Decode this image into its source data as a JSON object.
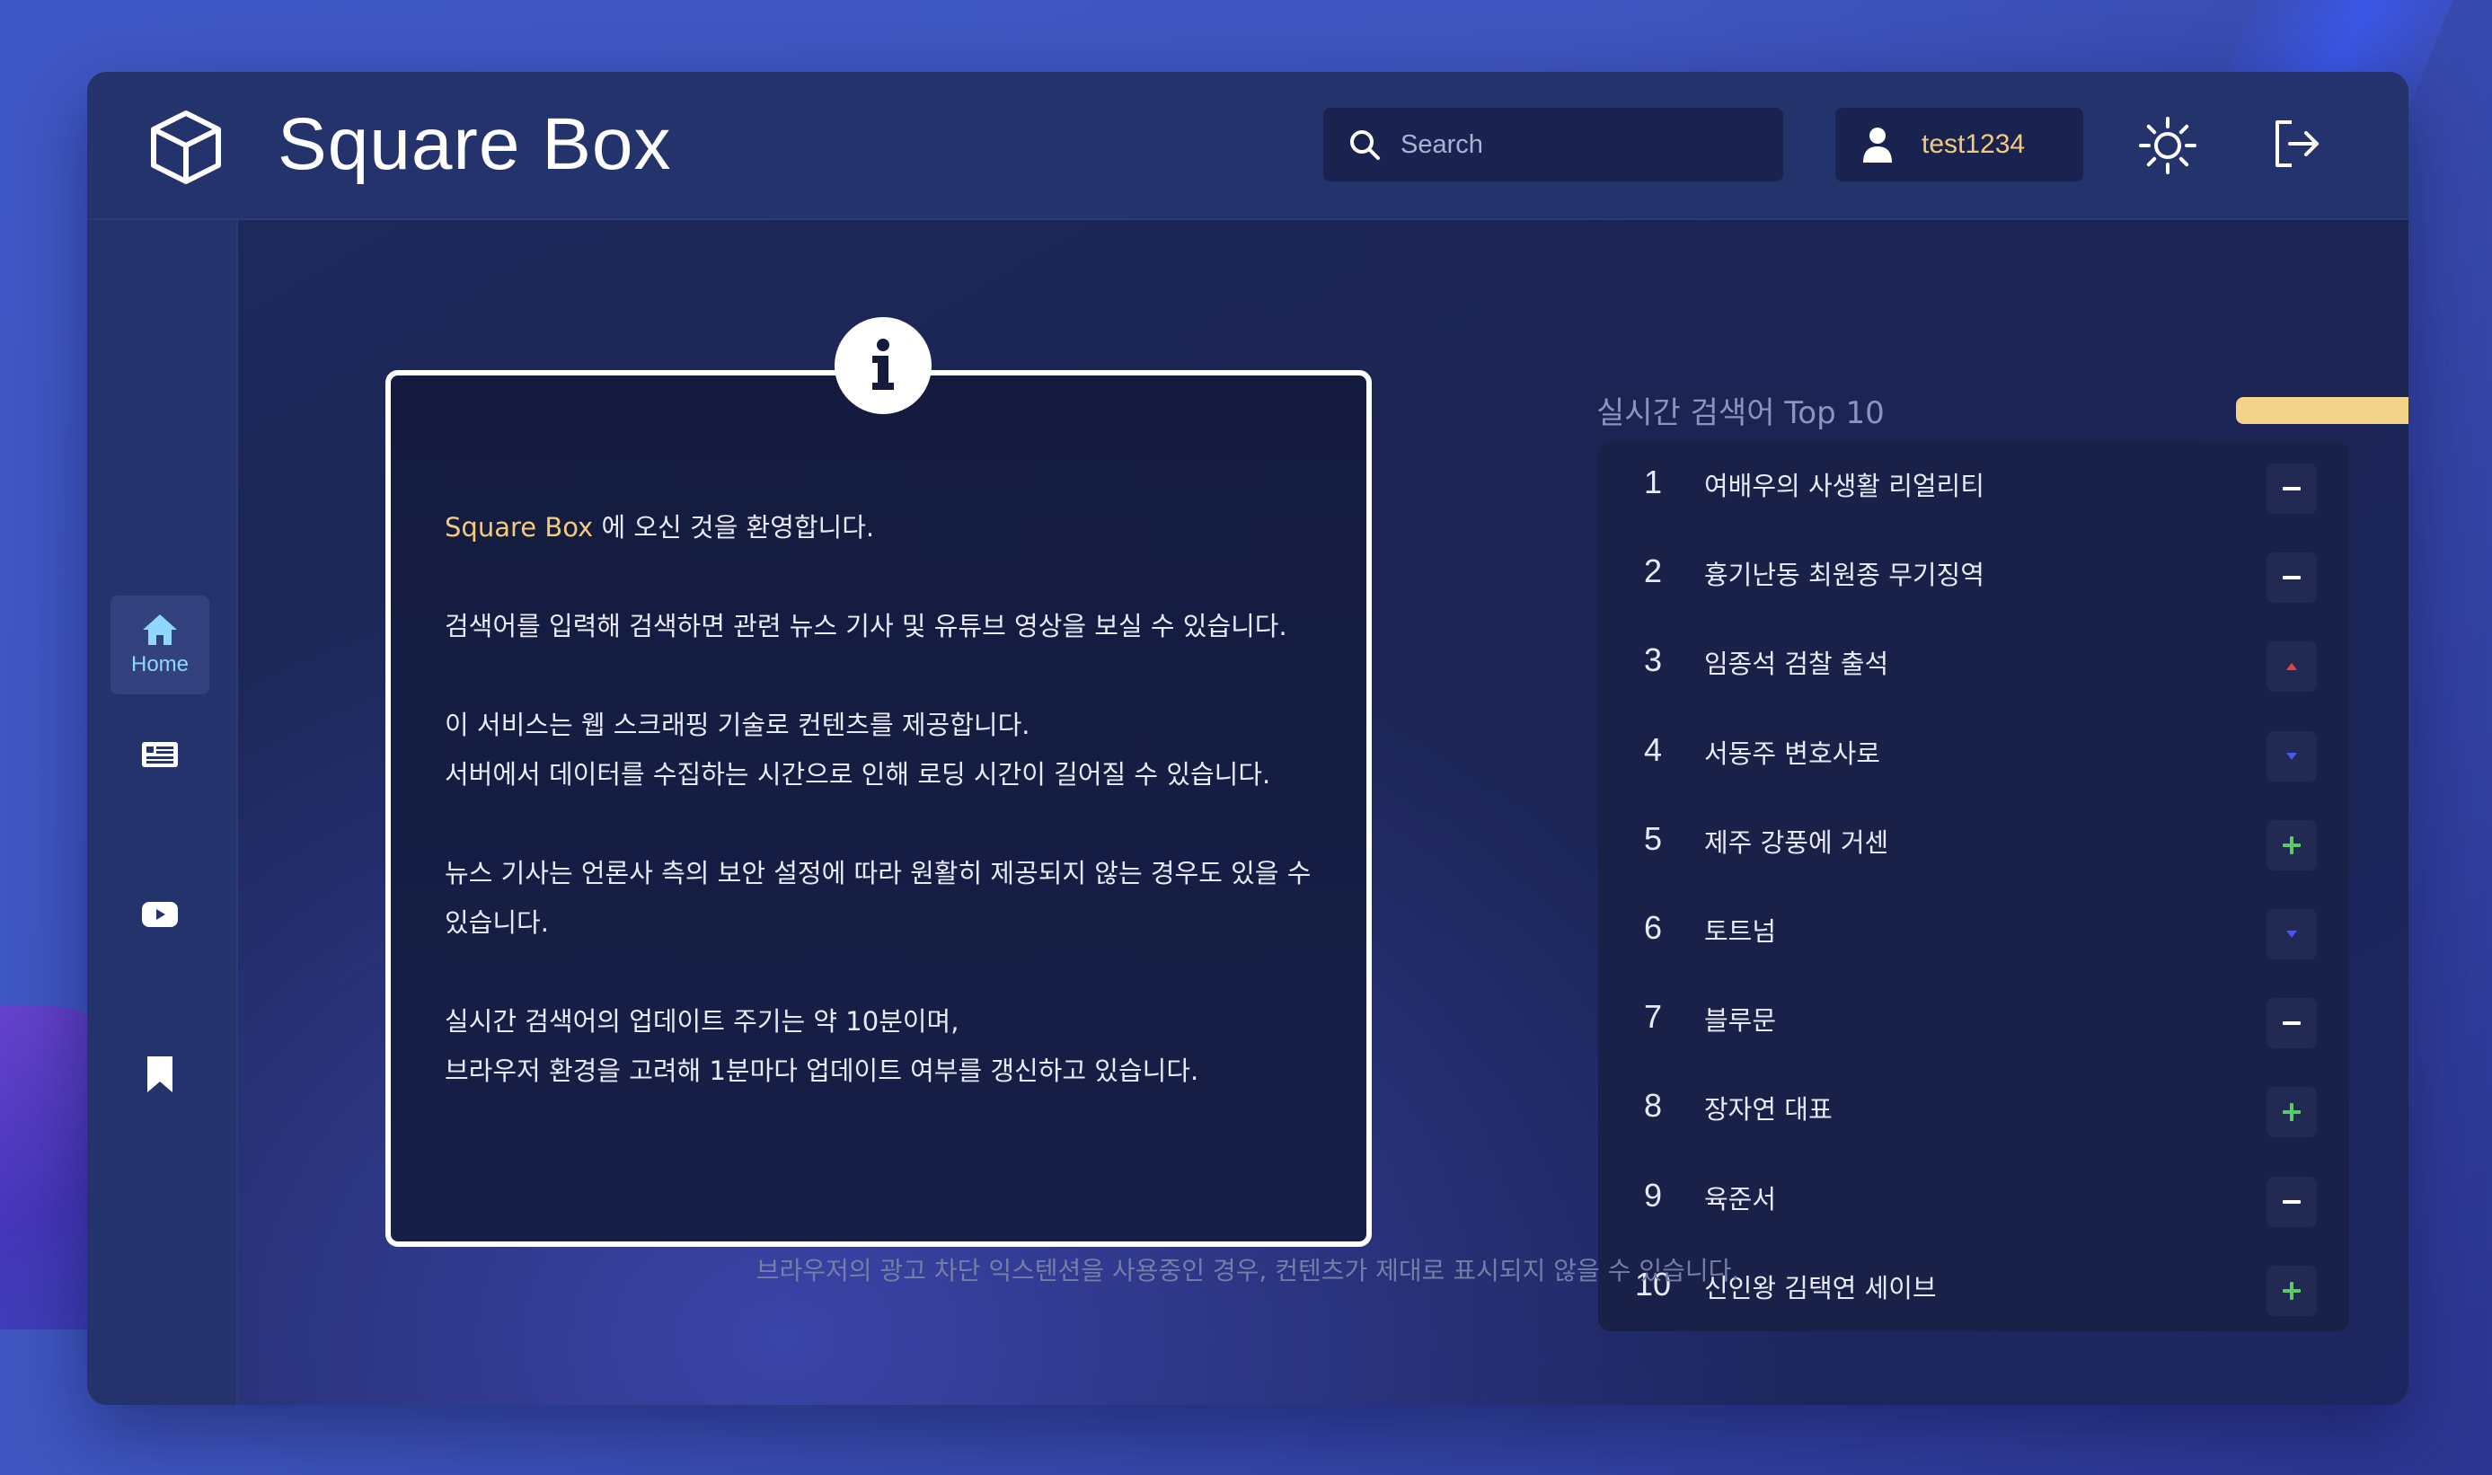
{
  "brand": {
    "name": "Square Box"
  },
  "header": {
    "search_placeholder": "Search",
    "username": "test1234"
  },
  "sidebar": {
    "items": [
      {
        "label": "Home",
        "icon": "home-icon",
        "active": true
      },
      {
        "label": "",
        "icon": "news-icon",
        "active": false
      },
      {
        "label": "",
        "icon": "youtube-icon",
        "active": false
      },
      {
        "label": "",
        "icon": "bookmark-icon",
        "active": false
      }
    ]
  },
  "info": {
    "brand": "Square Box",
    "welcome": " 에 오신 것을 환영합니다.",
    "p1": "검색어를 입력해 검색하면 관련 뉴스 기사 및 유튜브 영상을 보실 수 있습니다.",
    "p2a": "이 서비스는 웹 스크래핑 기술로 컨텐츠를 제공합니다.",
    "p2b": "서버에서 데이터를 수집하는 시간으로 인해 로딩 시간이 길어질 수 있습니다.",
    "p3": "뉴스 기사는 언론사 측의 보안 설정에 따라 원활히 제공되지 않는 경우도 있을 수 있습니다.",
    "p4a": "실시간 검색어의 업데이트 주기는 약 10분이며,",
    "p4b": "브라우저 환경을 고려해 1분마다 업데이트 여부를 갱신하고 있습니다."
  },
  "realtime": {
    "title": "실시간 검색어 Top 10",
    "update_progress": 0.9,
    "items": [
      {
        "rank": "1",
        "term": "여배우의 사생활 리얼리티",
        "status": "same"
      },
      {
        "rank": "2",
        "term": "흉기난동 최원종 무기징역",
        "status": "same"
      },
      {
        "rank": "3",
        "term": "임종석 검찰 출석",
        "status": "up"
      },
      {
        "rank": "4",
        "term": "서동주 변호사로",
        "status": "down"
      },
      {
        "rank": "5",
        "term": "제주 강풍에 거센",
        "status": "new"
      },
      {
        "rank": "6",
        "term": "토트넘",
        "status": "down"
      },
      {
        "rank": "7",
        "term": "블루문",
        "status": "same"
      },
      {
        "rank": "8",
        "term": "장자연 대표",
        "status": "new"
      },
      {
        "rank": "9",
        "term": "육준서",
        "status": "same"
      },
      {
        "rank": "10",
        "term": "신인왕 김택연 세이브",
        "status": "new"
      }
    ]
  },
  "footer": {
    "note": "브라우저의 광고 차단 익스텐션을 사용중인 경우, 컨텐츠가 제대로 표시되지 않을 수 있습니다."
  },
  "colors": {
    "accent": "#f3c97d",
    "up": "#e0443a",
    "down": "#4a56e8",
    "new": "#5cc96a",
    "same": "#ffffff"
  }
}
